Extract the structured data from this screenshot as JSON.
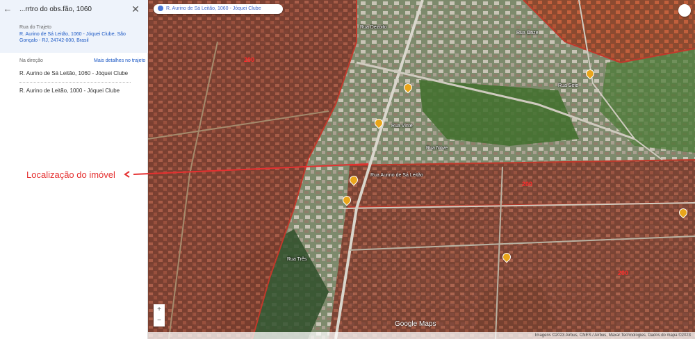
{
  "panel": {
    "title": "...rrtro do obs.fão, 1060",
    "section1_label": "Rua do Trajeto",
    "section1_address": "R. Aurino de Sá Leitão, 1060 - Jóquei Clube, São Gonçalo - RJ, 24742-000, Brasil",
    "section2_label": "Na direção",
    "details_link": "Mais detalhes no trajeto",
    "stop1": "R. Aurino de Sá Leitão, 1060 - Jóquei Clube",
    "stop2": "R. Aurino de Leitão, 1000 - Jóquei Clube",
    "back_icon": "arrow-left-icon",
    "close_icon": "close-icon"
  },
  "map": {
    "search_chip": "R. Aurino de Sá Leitão, 1060 - Jóquei Clube",
    "google_logo": "Google Maps",
    "attribution": "Imagens ©2023 Airbus, CNES / Airbus, Maxar Technologies, Dados do mapa ©2023",
    "zoom_in": "+",
    "zoom_out": "−",
    "red_tags": [
      "200",
      "200",
      "200"
    ],
    "labels": [
      "Rua Dezoito",
      "Rua Onze",
      "Rua Sete",
      "Rua Vinte",
      "Rua Aurino de Sá Leitão",
      "Rua Três",
      "Rua Nove"
    ],
    "colors": {
      "highlight_zone": "#c0392b",
      "annotation": "#e53030",
      "pin": "#e9a51b"
    }
  },
  "annotation": {
    "text": "Localização do imóvel"
  }
}
